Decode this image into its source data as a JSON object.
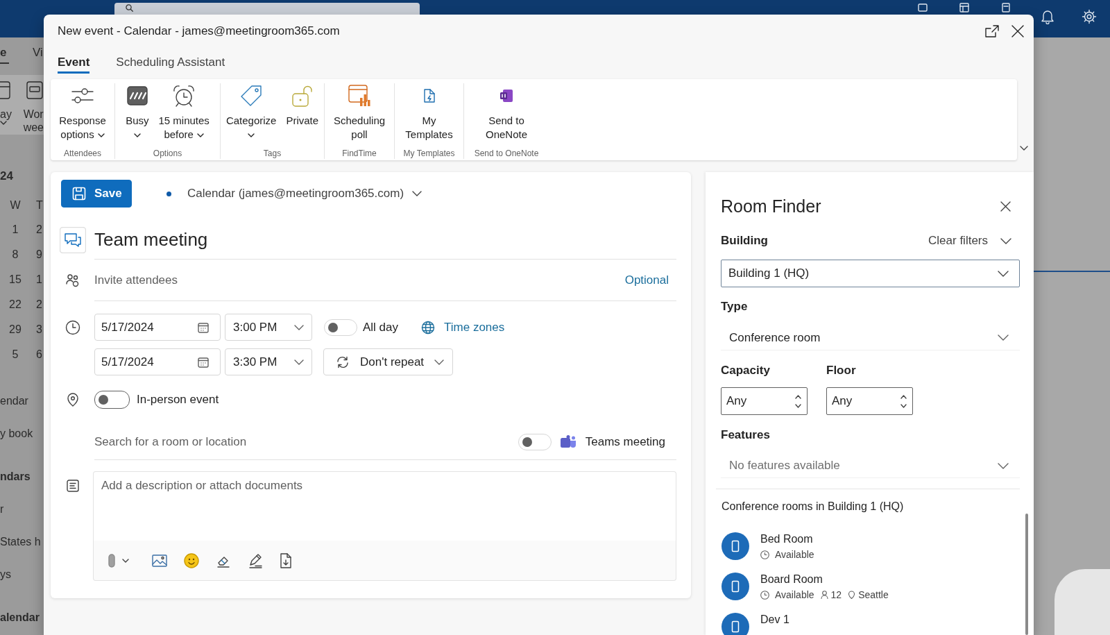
{
  "background": {
    "tabs": [
      {
        "label": "e",
        "selected": true
      },
      {
        "label": "Vi",
        "selected": false
      }
    ],
    "ribbon": [
      {
        "lines": [
          "ay"
        ],
        "dropdown": true
      },
      {
        "lines": [
          "Wor",
          "wee"
        ],
        "dropdown": false
      }
    ],
    "calendar": {
      "month": "24",
      "weekdays": [
        "W",
        "T"
      ],
      "weeks": [
        [
          "1",
          "2"
        ],
        [
          "8",
          "9"
        ],
        [
          "15",
          "1"
        ],
        [
          "22",
          "2"
        ],
        [
          "29",
          "3"
        ],
        [
          "5",
          "6"
        ]
      ]
    },
    "folders": [
      {
        "label": "endar",
        "kind": "item"
      },
      {
        "label": "y book",
        "kind": "item"
      },
      {
        "label": "ndars",
        "kind": "heading"
      },
      {
        "label": "r",
        "kind": "item"
      },
      {
        "label": "States h",
        "kind": "item"
      },
      {
        "label": "ys",
        "kind": "item"
      },
      {
        "label": "alendar",
        "kind": "heading"
      }
    ]
  },
  "window": {
    "title": "New event - Calendar - james@meetingroom365.com"
  },
  "tabs": [
    {
      "label": "Event",
      "selected": true
    },
    {
      "label": "Scheduling Assistant",
      "selected": false
    }
  ],
  "ribbon": [
    {
      "group": "Attendees",
      "buttons": [
        {
          "lines": [
            "Response",
            "options"
          ],
          "dropdown": true
        }
      ]
    },
    {
      "group": "Options",
      "buttons": [
        {
          "lines": [
            "Busy"
          ],
          "dropdown": true
        },
        {
          "lines": [
            "15 minutes",
            "before"
          ],
          "dropdown": true
        }
      ]
    },
    {
      "group": "Tags",
      "buttons": [
        {
          "lines": [
            "Categorize"
          ],
          "dropdown": true
        },
        {
          "lines": [
            "Private"
          ],
          "dropdown": false
        }
      ]
    },
    {
      "group": "FindTime",
      "buttons": [
        {
          "lines": [
            "Scheduling",
            "poll"
          ],
          "dropdown": false
        }
      ]
    },
    {
      "group": "My Templates",
      "buttons": [
        {
          "lines": [
            "My",
            "Templates"
          ],
          "dropdown": false
        }
      ]
    },
    {
      "group": "Send to OneNote",
      "buttons": [
        {
          "lines": [
            "Send to",
            "OneNote"
          ],
          "dropdown": false
        }
      ]
    }
  ],
  "event": {
    "save": "Save",
    "calendar": "Calendar (james@meetingroom365.com)",
    "title": "Team meeting",
    "attendees": {
      "placeholder": "Invite attendees",
      "optional": "Optional"
    },
    "start": {
      "date": "5/17/2024",
      "time": "3:00 PM"
    },
    "end": {
      "date": "5/17/2024",
      "time": "3:30 PM"
    },
    "all_day": {
      "label": "All day",
      "on": false
    },
    "time_zones": "Time zones",
    "repeat": "Don't repeat",
    "in_person": {
      "label": "In-person event",
      "on": false
    },
    "location": {
      "placeholder": "Search for a room or location"
    },
    "teams": {
      "label": "Teams meeting",
      "on": false
    },
    "description": {
      "placeholder": "Add a description or attach documents"
    }
  },
  "room_finder": {
    "title": "Room Finder",
    "building": {
      "label": "Building",
      "clear": "Clear filters",
      "value": "Building 1 (HQ)"
    },
    "type": {
      "label": "Type",
      "value": "Conference room"
    },
    "capacity": {
      "label": "Capacity",
      "value": "Any"
    },
    "floor": {
      "label": "Floor",
      "value": "Any"
    },
    "features": {
      "label": "Features",
      "placeholder": "No features available"
    },
    "results_heading": "Conference rooms in Building 1 (HQ)",
    "rooms": [
      {
        "name": "Bed Room",
        "status": "Available"
      },
      {
        "name": "Board Room",
        "status": "Available",
        "capacity": "12",
        "location": "Seattle"
      },
      {
        "name": "Dev 1"
      }
    ]
  }
}
